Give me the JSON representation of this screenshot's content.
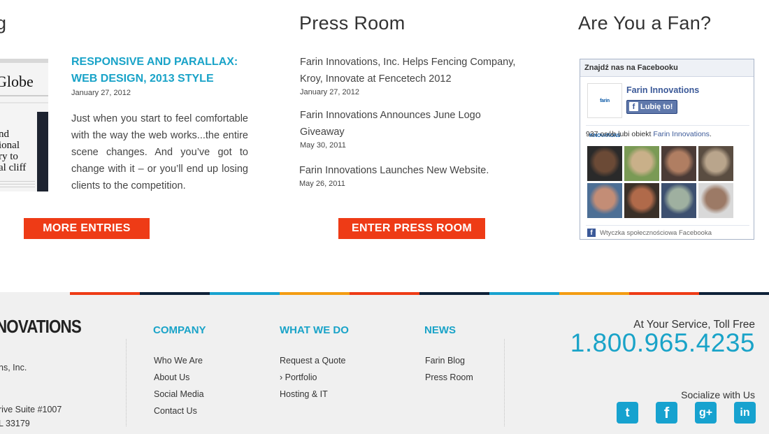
{
  "blog": {
    "heading_fragment": "g",
    "thumb_headline": "Globe",
    "thumb_lines": [
      "nd",
      "ional",
      "ry to",
      "al cliff"
    ],
    "post_title": "RESPONSIVE AND PARALLAX: WEB DESIGN, 2013 STYLE",
    "post_date": "January 27, 2012",
    "excerpt": "Just when you start to feel comfortable with the way the web works...the entire scene changes. And you’ve got to change with it – or you’ll end up losing clients to the competition.",
    "button_label": "MORE ENTRIES"
  },
  "press": {
    "heading": "Press Room",
    "items": [
      {
        "title": "Farin Innovations, Inc. Helps Fencing Company, Kroy, Innovate at Fencetech 2012",
        "date": "January 27, 2012"
      },
      {
        "title": "Farin Innovations Announces June Logo Giveaway",
        "date": "May 30, 2011"
      },
      {
        "title": "Farin Innovations Launches New Website.",
        "date": "May 26, 2011"
      }
    ],
    "button_label": "ENTER PRESS ROOM"
  },
  "fan": {
    "heading": "Are You a Fan?",
    "fb_header": "Znajdź nas na Facebooku",
    "logo_text": "farin INNOVATIONS",
    "page_name": "Farin Innovations",
    "like_label": "Lubię to!",
    "like_icon": "f",
    "count_prefix": "937 osób lubi obiekt ",
    "count_link": "Farin Innovations",
    "count_suffix": ".",
    "plugin_label": "Wtyczka społecznościowa Facebooka",
    "face_colors": [
      [
        "#2a2a2a",
        "#6b4a36"
      ],
      [
        "#7a9a55",
        "#c9b089"
      ],
      [
        "#4b3b36",
        "#b07e62"
      ],
      [
        "#5a4d41",
        "#b9a58c"
      ],
      [
        "#4d6f95",
        "#c38d76"
      ],
      [
        "#3a3028",
        "#b06a4a"
      ],
      [
        "#3d5070",
        "#9fb0a0"
      ],
      [
        "#d9d9d9",
        "#9c7a66"
      ]
    ]
  },
  "footer": {
    "logo_text": "NOVATIONS",
    "address_lines": [
      "ns, Inc.",
      "rive Suite #1007",
      "L 33179"
    ],
    "columns": [
      {
        "heading": "COMPANY",
        "links": [
          "Who We Are",
          "About Us",
          "Social Media",
          "Contact Us"
        ]
      },
      {
        "heading": "WHAT WE DO",
        "links": [
          "Request a Quote",
          "› Portfolio",
          "Hosting & IT"
        ]
      },
      {
        "heading": "NEWS",
        "links": [
          "Farin Blog",
          "Press Room"
        ]
      }
    ],
    "service_text": "At Your Service, Toll Free",
    "phone": "1.800.965.4235",
    "social_label": "Socialize with Us",
    "social_icons": [
      {
        "name": "twitter-icon",
        "glyph": "t"
      },
      {
        "name": "facebook-icon",
        "glyph": "f"
      },
      {
        "name": "google-plus-icon",
        "glyph": "g+"
      },
      {
        "name": "linkedin-icon",
        "glyph": "in"
      }
    ],
    "stripe_colors": [
      "#f0f0f0",
      "#ee3b16",
      "#0e2138",
      "#17a2cf",
      "#f39c12",
      "#ee3b16",
      "#0e2138",
      "#17a2cf",
      "#f39c12",
      "#ee3b16",
      "#0e2138"
    ]
  }
}
